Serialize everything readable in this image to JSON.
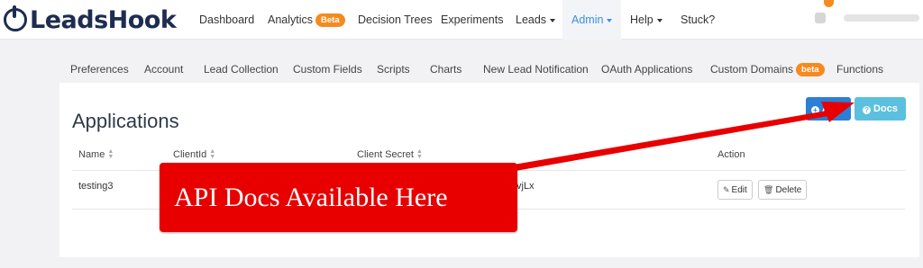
{
  "brand": {
    "name": "LeadsHook"
  },
  "topnav": {
    "items": [
      {
        "label": "Dashboard"
      },
      {
        "label": "Analytics",
        "badge": "Beta"
      },
      {
        "label": "Decision Trees"
      },
      {
        "label": "Experiments"
      },
      {
        "label": "Leads"
      },
      {
        "label": "Admin"
      },
      {
        "label": "Help"
      },
      {
        "label": "Stuck?"
      }
    ]
  },
  "subnav": {
    "items": [
      {
        "label": "Preferences"
      },
      {
        "label": "Account"
      },
      {
        "label": "Lead Collection"
      },
      {
        "label": "Custom Fields"
      },
      {
        "label": "Scripts"
      },
      {
        "label": "Charts"
      },
      {
        "label": "New Lead Notification"
      },
      {
        "label": "OAuth Applications"
      },
      {
        "label": "Custom Domains",
        "badge": "beta"
      },
      {
        "label": "Functions"
      }
    ]
  },
  "page": {
    "title": "Applications",
    "add_label": "Add",
    "docs_label": "Docs"
  },
  "table": {
    "headers": [
      "Name",
      "ClientId",
      "Client Secret",
      "Action"
    ],
    "rows": [
      {
        "name": "testing3",
        "secret_fragment": "vjLx",
        "edit_label": "Edit",
        "delete_label": "Delete"
      }
    ]
  },
  "callout": {
    "text": "API Docs Available Here"
  },
  "colors": {
    "accent": "#3b8ee6",
    "callout": "#e80000",
    "badge": "#f68a1f",
    "add": "#2b7fd6",
    "docs": "#5bc0de"
  }
}
